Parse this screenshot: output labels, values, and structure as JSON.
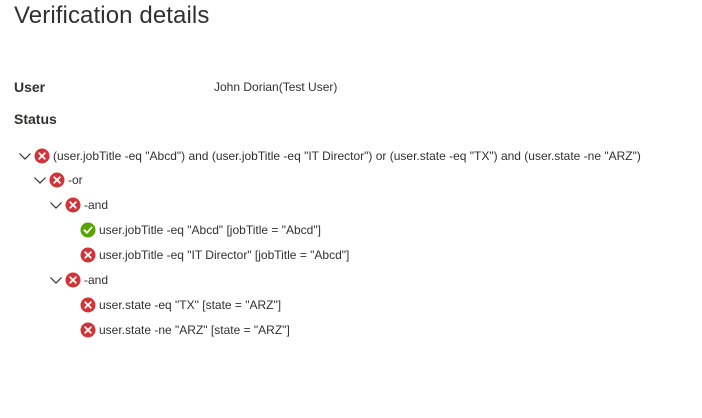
{
  "page": {
    "title": "Verification details"
  },
  "details": {
    "user_label": "User",
    "user_value": "John Dorian(Test User)",
    "status_label": "Status"
  },
  "colors": {
    "fail": "#d13438",
    "pass": "#57a300",
    "chevron": "#323130"
  },
  "tree": {
    "root": {
      "text": "(user.jobTitle -eq \"Abcd\") and (user.jobTitle -eq \"IT Director\") or (user.state -eq \"TX\") and (user.state -ne \"ARZ\")",
      "status": "fail",
      "expanded": true
    },
    "or_node": {
      "text": "-or",
      "status": "fail",
      "expanded": true
    },
    "and_node_1": {
      "text": "-and",
      "status": "fail",
      "expanded": true
    },
    "leaf_1": {
      "text": "user.jobTitle -eq \"Abcd\" [jobTitle = \"Abcd\"]",
      "status": "pass"
    },
    "leaf_2": {
      "text": "user.jobTitle -eq \"IT Director\" [jobTitle = \"Abcd\"]",
      "status": "fail"
    },
    "and_node_2": {
      "text": "-and",
      "status": "fail",
      "expanded": true
    },
    "leaf_3": {
      "text": "user.state -eq \"TX\" [state = \"ARZ\"]",
      "status": "fail"
    },
    "leaf_4": {
      "text": "user.state -ne \"ARZ\" [state = \"ARZ\"]",
      "status": "fail"
    }
  }
}
